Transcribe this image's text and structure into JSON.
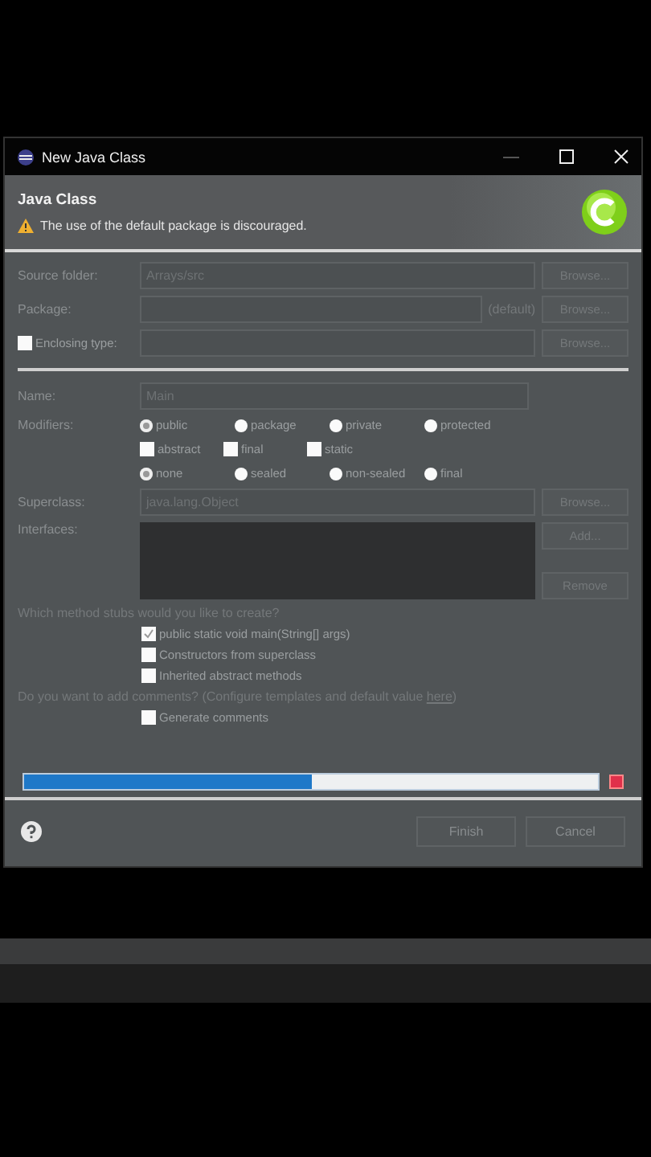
{
  "window": {
    "title": "New Java Class"
  },
  "header": {
    "title": "Java Class",
    "message": "The use of the default package is discouraged."
  },
  "fields": [
    {
      "kind": "text",
      "label": "Source folder:",
      "value": "Arrays/src",
      "button": "Browse..."
    },
    {
      "kind": "suffix",
      "label": "Package:",
      "suffix": "(default)",
      "button": "Browse..."
    },
    {
      "kind": "check",
      "label": "Enclosing type:",
      "checked": false,
      "button": "Browse..."
    }
  ],
  "name": {
    "label": "Name:",
    "value": "Main"
  },
  "modifiers": {
    "label": "Modifiers:",
    "rows": [
      {
        "kind": "radio",
        "items": [
          {
            "label": "public",
            "selected": true
          },
          {
            "label": "package",
            "selected": false
          },
          {
            "label": "private",
            "selected": false
          },
          {
            "label": "protected",
            "selected": false
          }
        ]
      },
      {
        "kind": "check",
        "items": [
          {
            "label": "abstract",
            "checked": false
          },
          {
            "label": "final",
            "checked": false
          },
          {
            "label": "static",
            "checked": false
          }
        ]
      },
      {
        "kind": "radio",
        "items": [
          {
            "label": "none",
            "selected": true
          },
          {
            "label": "sealed",
            "selected": false
          },
          {
            "label": "non-sealed",
            "selected": false
          },
          {
            "label": "final",
            "selected": false
          }
        ]
      }
    ]
  },
  "superclass": {
    "label": "Superclass:",
    "value": "java.lang.Object",
    "button": "Browse..."
  },
  "interfaces": {
    "label": "Interfaces:",
    "add": "Add...",
    "remove": "Remove"
  },
  "stubs": {
    "question": "Which method stubs would you like to create?",
    "options": [
      {
        "label": "public static void main(String[] args)",
        "checked": true
      },
      {
        "label": "Constructors from superclass",
        "checked": false
      },
      {
        "label": "Inherited abstract methods",
        "checked": false
      }
    ]
  },
  "comments": {
    "before": "Do you want to add comments? (Configure templates and default value ",
    "link": "here",
    "after": ")",
    "option": {
      "label": "Generate comments",
      "checked": false
    }
  },
  "progress": {
    "level": 0.5
  },
  "buttons": [
    "Finish",
    "Cancel"
  ]
}
